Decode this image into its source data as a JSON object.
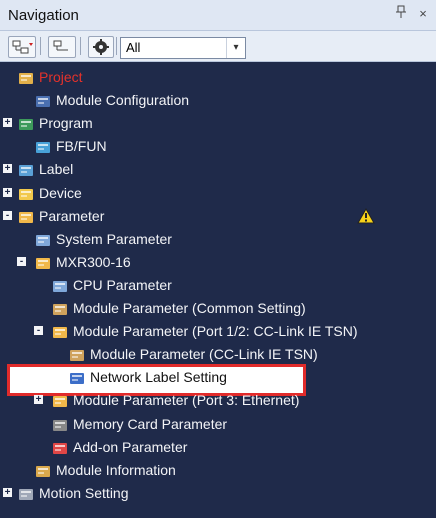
{
  "panel": {
    "title": "Navigation",
    "pin_icon": "pin-icon",
    "close_icon": "close-icon",
    "close_label": "×"
  },
  "toolbar": {
    "filter_value": "All",
    "dropdown_arrow": "▾"
  },
  "tree": [
    {
      "label": "Project",
      "depth": 0,
      "expander": "",
      "icon": "project-icon",
      "color": "#e4322b"
    },
    {
      "label": "Module Configuration",
      "depth": 1,
      "expander": "",
      "icon": "module-config-icon"
    },
    {
      "label": "Program",
      "depth": 0,
      "expander": "+",
      "icon": "program-icon"
    },
    {
      "label": "FB/FUN",
      "depth": 1,
      "expander": "",
      "icon": "fbfun-icon"
    },
    {
      "label": "Label",
      "depth": 0,
      "expander": "+",
      "icon": "label-icon"
    },
    {
      "label": "Device",
      "depth": 0,
      "expander": "+",
      "icon": "device-icon"
    },
    {
      "label": "Parameter",
      "depth": 0,
      "expander": "-",
      "icon": "parameter-icon",
      "warning": true
    },
    {
      "label": "System Parameter",
      "depth": 1,
      "expander": "",
      "icon": "system-parameter-icon"
    },
    {
      "label": "MXR300-16",
      "depth": 1,
      "expander": "-",
      "icon": "cpu-folder-icon"
    },
    {
      "label": "CPU Parameter",
      "depth": 2,
      "expander": "",
      "icon": "cpu-parameter-icon"
    },
    {
      "label": "Module Parameter (Common Setting)",
      "depth": 2,
      "expander": "",
      "icon": "module-parameter-icon"
    },
    {
      "label": "Module Parameter (Port 1/2: CC-Link IE TSN)",
      "depth": 2,
      "expander": "-",
      "icon": "module-parameter-folder-icon"
    },
    {
      "label": "Module Parameter (CC-Link IE TSN)",
      "depth": 3,
      "expander": "",
      "icon": "module-parameter-icon"
    },
    {
      "label": "Network Label Setting",
      "depth": 3,
      "expander": "",
      "icon": "network-label-icon",
      "highlight": true
    },
    {
      "label": "Module Parameter (Port 3: Ethernet)",
      "depth": 2,
      "expander": "+",
      "icon": "module-parameter-folder-icon"
    },
    {
      "label": "Memory Card Parameter",
      "depth": 2,
      "expander": "",
      "icon": "memory-card-icon"
    },
    {
      "label": "Add-on Parameter",
      "depth": 2,
      "expander": "",
      "icon": "add-on-icon"
    },
    {
      "label": "Module Information",
      "depth": 1,
      "expander": "",
      "icon": "module-information-icon"
    },
    {
      "label": "Motion Setting",
      "depth": 0,
      "expander": "+",
      "icon": "motion-setting-icon"
    }
  ]
}
